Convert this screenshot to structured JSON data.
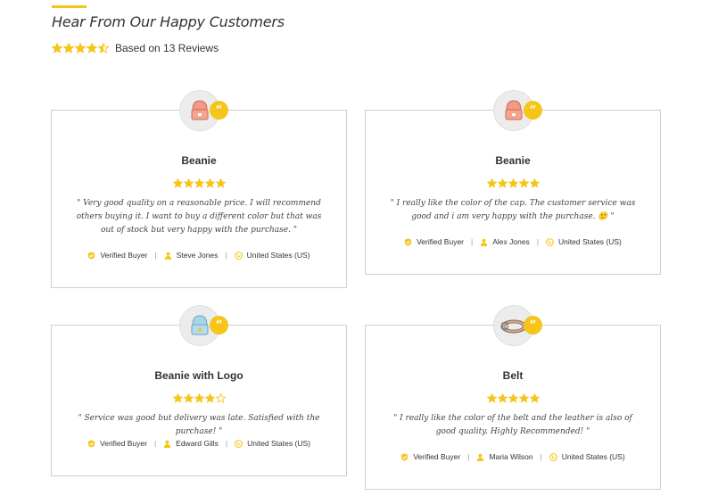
{
  "header": {
    "title": "Hear From Our Happy Customers",
    "summary_text": "Based on 13 Reviews",
    "rating": 4.5
  },
  "colors": {
    "accent": "#f5c518",
    "border": "#cfcfcf",
    "text": "#333333"
  },
  "reviews": [
    {
      "product": "Beanie",
      "rating": 5,
      "text": "\" Very good quality on a reasonable price. I will recommend others buying it. I want to buy a different color but that was out of stock but very happy with the purchase. \"",
      "verified": "Verified Buyer",
      "name": "Steve Jones",
      "country": "United States (US)",
      "image_icon": "pink-beanie-icon"
    },
    {
      "product": "Beanie",
      "rating": 5,
      "text": "\" I really like the color of the cap. The customer service was good and i am very happy with the purchase. 🙂 \"",
      "verified": "Verified Buyer",
      "name": "Alex Jones",
      "country": "United States (US)",
      "image_icon": "pink-beanie-icon"
    },
    {
      "product": "Beanie with Logo",
      "rating": 4,
      "text": "\" Service was good but delivery was late. Satisfied with the purchase! \"",
      "verified": "Verified Buyer",
      "name": "Edward Gills",
      "country": "United States (US)",
      "image_icon": "blue-beanie-icon"
    },
    {
      "product": "Belt",
      "rating": 5,
      "text": "\" I really like the color of the belt and the leather is also of good quality. Highly Recommended! \"",
      "verified": "Verified Buyer",
      "name": "Maria Wilson",
      "country": "United States (US)",
      "image_icon": "belt-icon"
    }
  ]
}
